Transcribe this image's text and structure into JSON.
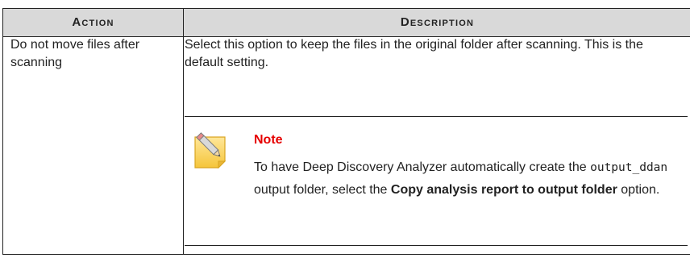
{
  "table": {
    "headers": {
      "action": "Action",
      "description": "Description"
    },
    "rows": [
      {
        "action": "Do not move files after scanning",
        "description": "Select this option to keep the files in the original folder after scanning. This is the default setting."
      }
    ]
  },
  "note": {
    "icon": "note-pencil-icon",
    "title": "Note",
    "text_before_folder": "To have Deep Discovery Analyzer automatically create the",
    "folder_name": "output_ddan",
    "text_after_folder": "output folder, select the",
    "option_name": "Copy analysis report to output folder",
    "text_end": "option."
  },
  "colors": {
    "header_bg": "#d9d9d9",
    "note_title": "#e60000",
    "border": "#222222"
  }
}
